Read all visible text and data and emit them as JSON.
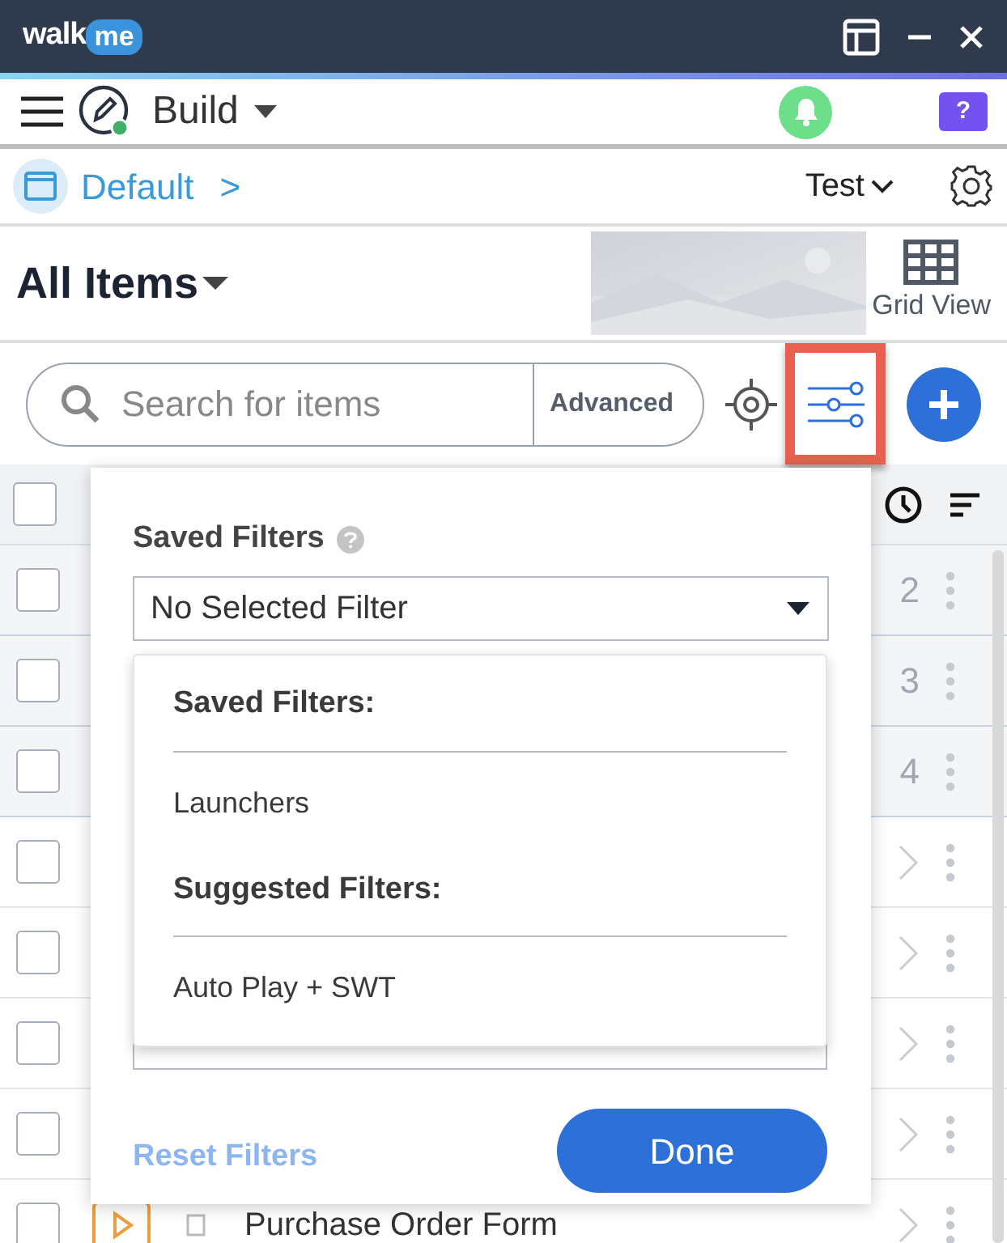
{
  "title_bar": {
    "logo_left": "walk",
    "logo_right": "me"
  },
  "toolbar": {
    "mode": "Build",
    "help": "?"
  },
  "breadcrumb": {
    "item": "Default",
    "separator": ">",
    "environment": "Test"
  },
  "header": {
    "title": "All Items",
    "view_toggle": "Grid View"
  },
  "search": {
    "placeholder": "Search for items",
    "advanced": "Advanced"
  },
  "filter_button": {
    "highlighted": true
  },
  "table": {
    "select_all_checked": false,
    "pinned_rows": [
      {
        "checked": false,
        "number": "2"
      },
      {
        "checked": false,
        "number": "3"
      },
      {
        "checked": false,
        "number": "4"
      }
    ],
    "rows": [
      {
        "checked": false
      },
      {
        "checked": false
      },
      {
        "checked": false
      },
      {
        "checked": false
      },
      {
        "checked": false,
        "title": "Purchase Order Form"
      }
    ]
  },
  "filter_panel": {
    "title": "Saved Filters",
    "selected_filter": "No Selected Filter",
    "menu": [
      {
        "kind": "heading",
        "text": "Saved Filters:"
      },
      {
        "kind": "option",
        "text": "Launchers"
      },
      {
        "kind": "heading",
        "text": "Suggested Filters:"
      },
      {
        "kind": "option",
        "text": "Auto Play + SWT"
      }
    ],
    "reset": "Reset Filters",
    "done": "Done"
  }
}
